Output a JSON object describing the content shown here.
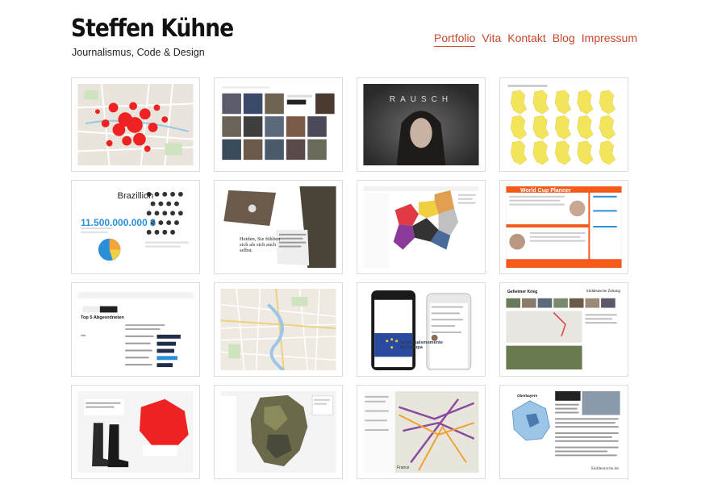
{
  "header": {
    "title": "Steffen Kühne",
    "subtitle": "Journalismus, Code & Design"
  },
  "nav": [
    {
      "label": "Portfolio",
      "active": true
    },
    {
      "label": "Vita",
      "active": false
    },
    {
      "label": "Kontakt",
      "active": false
    },
    {
      "label": "Blog",
      "active": false
    },
    {
      "label": "Impressum",
      "active": false
    }
  ],
  "colors": {
    "accent": "#c9472c",
    "map_red": "#ee2222",
    "map_yellow": "#f2e55c",
    "wm_orange": "#f35a1c",
    "blue": "#2b8ed8"
  },
  "tiles": {
    "brazillion": {
      "title": "Brazillion",
      "amount": "11.500.000.000 $"
    },
    "rausch": {
      "title": "RAUSCH"
    },
    "wm": {
      "title": "World Cup Planner"
    },
    "heiden": {
      "text": "Heiden, Sie fühlten sich als sich auch selbst."
    },
    "top5": {
      "title": "Top 5 Abgeordneten"
    },
    "germany_app": {
      "headline": "Schicksalsmomente für Europa"
    },
    "geheimer_krieg": {
      "title": "Geheimer Krieg",
      "logo": "Süddeutsche Zeitung"
    },
    "france": {
      "label": "France"
    },
    "oberbayern": {
      "label": "Oberbayern",
      "footer": "Süddeutsche.de"
    }
  }
}
